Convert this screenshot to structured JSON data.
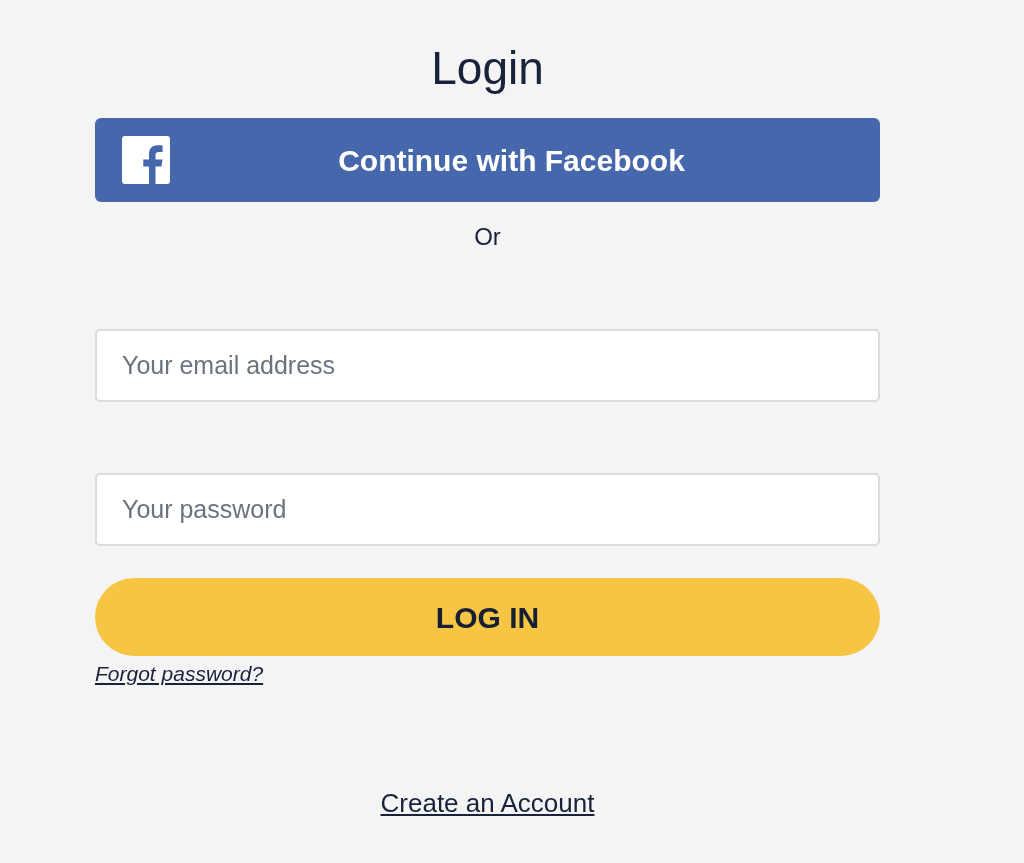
{
  "title": "Login",
  "facebook_button": {
    "label": "Continue with Facebook"
  },
  "separator": "Or",
  "fields": [
    {
      "placeholder": "Your email address"
    },
    {
      "placeholder": "Your password"
    }
  ],
  "login_button": {
    "label": "LOG IN"
  },
  "forgot_link": "Forgot password?",
  "create_account_link": "Create an Account"
}
